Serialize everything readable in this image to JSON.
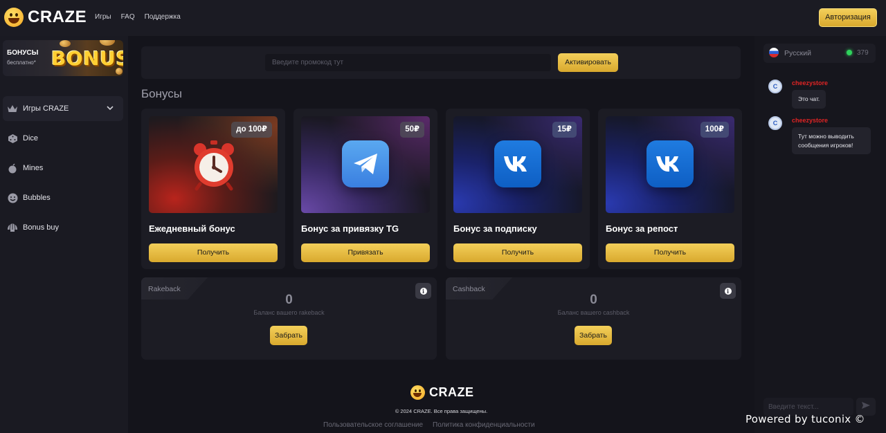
{
  "brand": {
    "name": "CRAZE"
  },
  "nav": [
    {
      "label": "Игры"
    },
    {
      "label": "FAQ"
    },
    {
      "label": "Поддержка"
    }
  ],
  "auth_label": "Авторизация",
  "sidebar": {
    "banner_title": "БОНУСЫ",
    "banner_subtitle": "бесплатно*",
    "banner_big": "BONUS",
    "games_label": "Игры CRAZE",
    "items": [
      {
        "label": "Dice",
        "icon": "dice-icon"
      },
      {
        "label": "Mines",
        "icon": "mine-icon"
      },
      {
        "label": "Bubbles",
        "icon": "smiley-icon"
      },
      {
        "label": "Bonus buy",
        "icon": "shell-icon"
      }
    ]
  },
  "promo": {
    "placeholder": "Введите промокод тут",
    "button": "Активировать"
  },
  "bonuses": {
    "title": "Бонусы",
    "cards": [
      {
        "price": "до 100₽",
        "title": "Ежедневный бонус",
        "button": "Получить",
        "icon": "alarm-clock-icon"
      },
      {
        "price": "50₽",
        "title": "Бонус за привязку TG",
        "button": "Привязать",
        "icon": "telegram-icon"
      },
      {
        "price": "15₽",
        "title": "Бонус за подписку",
        "button": "Получить",
        "icon": "vk-icon"
      },
      {
        "price": "100₽",
        "title": "Бонус за репост",
        "button": "Получить",
        "icon": "vk-icon"
      }
    ]
  },
  "rakeback": {
    "label": "Rakeback",
    "value": "0",
    "subtitle": "Баланс вашего rakeback",
    "button": "Забрать"
  },
  "cashback": {
    "label": "Cashback",
    "value": "0",
    "subtitle": "Баланс вашего cashback",
    "button": "Забрать"
  },
  "footer": {
    "copyright": "© 2024 CRAZE. Все права защищены.",
    "links": [
      "Пользовательское соглашение",
      "Политика конфиденциальности"
    ]
  },
  "chat": {
    "language": "Русский",
    "online": "379",
    "messages": [
      {
        "author": "cheezystore",
        "text": "Это чат."
      },
      {
        "author": "cheezystore",
        "text": "Тут можно выводить сообщения игроков!"
      }
    ],
    "input_placeholder": "Введите текст..."
  },
  "watermark": "Powered by tuconix ©"
}
